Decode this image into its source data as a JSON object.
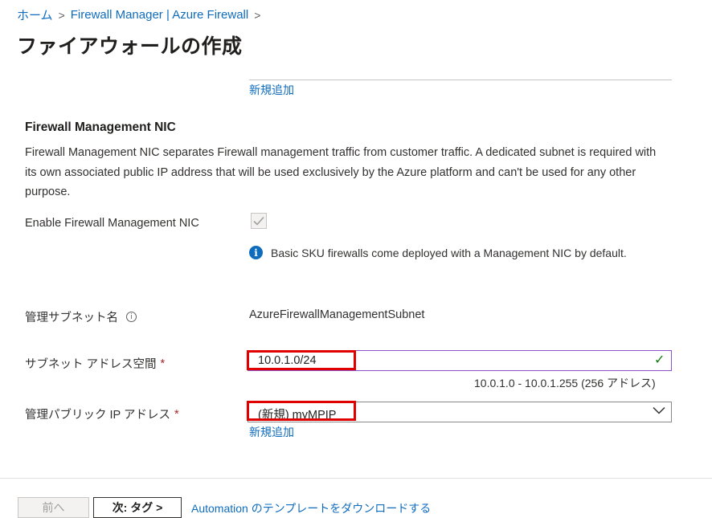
{
  "breadcrumb": {
    "home": "ホーム",
    "separator": ">",
    "parent": "Firewall Manager | Azure Firewall"
  },
  "page": {
    "title": "ファイアウォールの作成",
    "more": "···"
  },
  "top_new_link": "新規追加",
  "management_nic": {
    "heading": "Firewall Management NIC",
    "description": "Firewall Management NIC separates Firewall management traffic from customer traffic. A dedicated subnet is required with its own associated public IP address that will be used exclusively by the Azure platform and can't be used for any other purpose.",
    "enable_label": "Enable Firewall Management NIC",
    "enabled": true,
    "info_icon": "i",
    "info_text": "Basic SKU firewalls come deployed with a Management NIC by default."
  },
  "fields": {
    "subnet_name_label": "管理サブネット名",
    "subnet_name_tip": "i",
    "subnet_name_value": "AzureFirewallManagementSubnet",
    "address_space_label": "サブネット アドレス空間",
    "address_space_value": "10.0.1.0/24",
    "address_range": "10.0.1.0 - 10.0.1.255 (256 アドレス)",
    "public_ip_label": "管理パブリック IP アドレス",
    "public_ip_value": "(新規) myMPIP",
    "new_link": "新規追加",
    "required_mark": "*"
  },
  "footer": {
    "prev": "前へ",
    "next": "次: タグ >",
    "automation": "Automation のテンプレートをダウンロードする"
  },
  "colors": {
    "link": "#0f6cbd",
    "highlight": "#e00000",
    "focus_border": "#8a54c8",
    "valid_check": "#107c10"
  }
}
